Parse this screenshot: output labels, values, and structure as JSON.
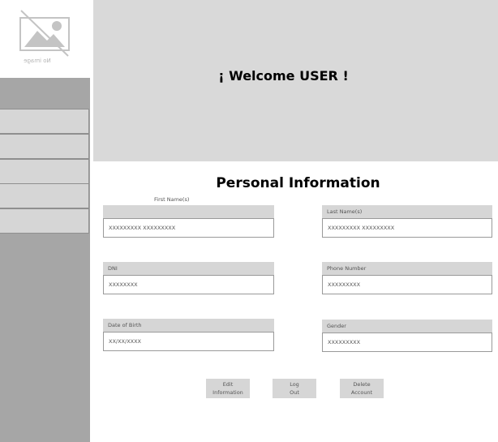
{
  "logo": {
    "no_image_text": "No image"
  },
  "banner": {
    "welcome": "¡ Welcome USER !"
  },
  "sidebar": {
    "items": [
      "",
      "",
      "",
      "",
      ""
    ]
  },
  "personal": {
    "title": "Personal Information",
    "first_name": {
      "label": "First Name(s)",
      "value": "XXXXXXXXX XXXXXXXXX"
    },
    "last_name": {
      "label": "Last Name(s)",
      "value": "XXXXXXXXX XXXXXXXXX"
    },
    "dni": {
      "label": "DNI",
      "value": "XXXXXXXX"
    },
    "phone": {
      "label": "Phone Number",
      "value": "XXXXXXXXX"
    },
    "dob": {
      "label": "Date of Birth",
      "value": "XX/XX/XXXX"
    },
    "gender": {
      "label": "Gender",
      "value": "XXXXXXXXX"
    }
  },
  "actions": {
    "edit_line1": "Edit",
    "edit_line2": "Information",
    "logout_line1": "Log",
    "logout_line2": "Out",
    "delete_line1": "Delete",
    "delete_line2": "Account"
  }
}
